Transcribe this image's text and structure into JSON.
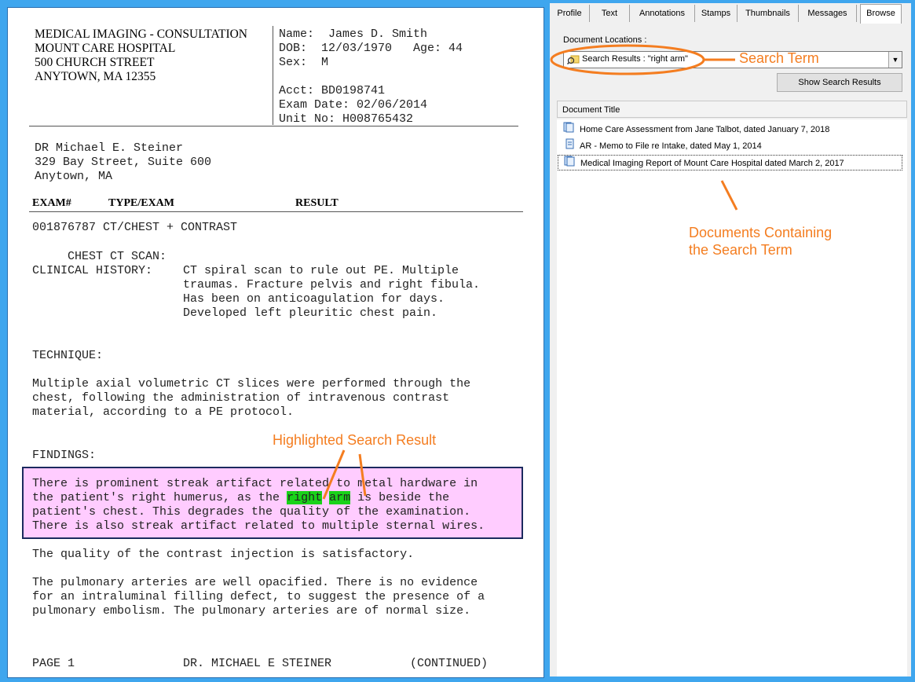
{
  "document": {
    "header_left": [
      "MEDICAL IMAGING - CONSULTATION",
      "MOUNT CARE HOSPITAL",
      "500 CHURCH STREET",
      "ANYTOWN, MA 12355"
    ],
    "name_line": "Name:  James D. Smith",
    "dob_line": "DOB:  12/03/1970   Age: 44",
    "sex_line": "Sex:  M",
    "acct_line": "Acct: BD0198741",
    "exam_date_line": "Exam Date: 02/06/2014",
    "unit_line": "Unit No: H008765432",
    "doctor_lines": [
      "DR Michael E. Steiner",
      "329 Bay Street, Suite 600",
      "Anytown, MA"
    ],
    "col_exam": "EXAM#",
    "col_type": "TYPE/EXAM",
    "col_result": "RESULT",
    "exam_line": "001876787 CT/CHEST + CONTRAST",
    "chest_ct": "     CHEST CT SCAN:",
    "clinical_label": "CLINICAL HISTORY:",
    "clinical_lines": [
      "CT spiral scan to rule out PE. Multiple",
      "traumas. Fracture pelvis and right fibula.",
      "Has been on anticoagulation for days.",
      "Developed left pleuritic chest pain."
    ],
    "technique_label": "TECHNIQUE:",
    "technique_lines": [
      "Multiple axial volumetric CT slices were performed through the",
      "chest, following the administration of intravenous contrast",
      "material, according to a PE protocol."
    ],
    "findings_label": "FINDINGS:",
    "findings_line1": "There is prominent streak artifact related to metal hardware in",
    "findings_line2_a": "the patient's right humerus, as the ",
    "findings_hit1": "right",
    "findings_space": " ",
    "findings_hit2": "arm",
    "findings_line2_b": " is beside the",
    "findings_line3": "patient's chest. This degrades the quality of the examination.",
    "findings_line4": "There is also streak artifact related to multiple sternal wires.",
    "quality_line": "The quality of the contrast injection is satisfactory.",
    "pulmonary_lines": [
      "The pulmonary arteries are well opacified. There is no evidence",
      "for an intraluminal filling defect, to suggest the presence of a",
      "pulmonary embolism. The pulmonary arteries are of normal size."
    ],
    "footer_page": "PAGE 1",
    "footer_doctor": "DR. MICHAEL E STEINER",
    "footer_continued": "(CONTINUED)"
  },
  "tabs": [
    "Profile",
    "Text",
    "Annotations",
    "Stamps",
    "Thumbnails",
    "Messages",
    "Browse"
  ],
  "active_tab": "Browse",
  "browse": {
    "locations_label": "Document Locations :",
    "combo_value": "Search Results : \"right arm\"",
    "show_results_button": "Show Search Results",
    "list_header": "Document Title",
    "documents": [
      "Home Care Assessment from Jane Talbot, dated January 7, 2018",
      "AR - Memo to File re Intake, dated May 1, 2014",
      "Medical Imaging Report of Mount Care Hospital dated March 2, 2017"
    ]
  },
  "annotations": {
    "search_term": "Search Term",
    "highlighted": "Highlighted Search Result",
    "documents_containing_1": "Documents Containing",
    "documents_containing_2": "the Search Term"
  },
  "colors": {
    "frame": "#3fa6ee",
    "annotation": "#f47d20",
    "highlight_box": "#ffccff",
    "hit": "#19d219"
  }
}
